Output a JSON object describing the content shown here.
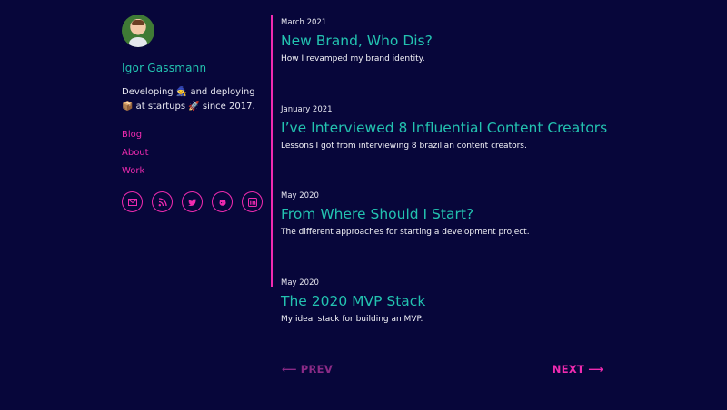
{
  "profile": {
    "name": "Igor Gassmann",
    "bio": "Developing 🧙 and deploying 📦 at startups 🚀 since 2017."
  },
  "nav": [
    {
      "label": "Blog"
    },
    {
      "label": "About"
    },
    {
      "label": "Work"
    }
  ],
  "socials": [
    {
      "icon": "email-icon"
    },
    {
      "icon": "rss-icon"
    },
    {
      "icon": "twitter-icon"
    },
    {
      "icon": "github-icon"
    },
    {
      "icon": "linkedin-icon"
    }
  ],
  "posts": [
    {
      "date": "March 2021",
      "title": "New Brand, Who Dis?",
      "description": "How I revamped my brand identity."
    },
    {
      "date": "January 2021",
      "title": "I’ve Interviewed 8 Influential Content Creators",
      "description": "Lessons I got from interviewing 8 brazilian content creators."
    },
    {
      "date": "May 2020",
      "title": "From Where Should I Start?",
      "description": "The different approaches for starting a development project."
    },
    {
      "date": "May 2020",
      "title": "The 2020 MVP Stack",
      "description": "My ideal stack for building an MVP."
    }
  ],
  "pagination": {
    "prev_label": "PREV",
    "next_label": "NEXT"
  },
  "colors": {
    "background": "#07063a",
    "accent_pink": "#f02bb0",
    "accent_teal": "#23c2b0"
  }
}
